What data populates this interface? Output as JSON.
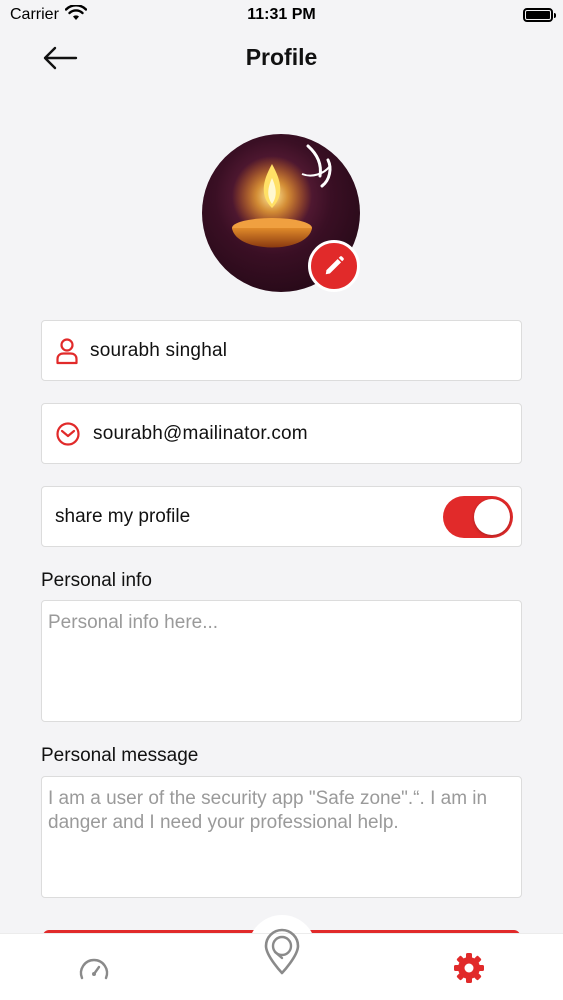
{
  "status_bar": {
    "carrier": "Carrier",
    "time": "11:31 PM"
  },
  "header": {
    "title": "Profile"
  },
  "profile": {
    "name": "sourabh singhal",
    "email": "sourabh@mailinator.com",
    "share_label": "share my profile",
    "share_enabled": true
  },
  "personal_info": {
    "label": "Personal info",
    "placeholder": "Personal info here..."
  },
  "personal_message": {
    "label": "Personal message",
    "value": "I am a user of the security app \"Safe zone\".“. I am in danger and I need your professional help."
  },
  "tabs": [
    {
      "icon": "speedometer-icon"
    },
    {
      "icon": "location-pin-icon"
    },
    {
      "icon": "settings-gear-icon"
    }
  ],
  "colors": {
    "accent": "#e12a2a",
    "background": "#f4f4f6"
  }
}
